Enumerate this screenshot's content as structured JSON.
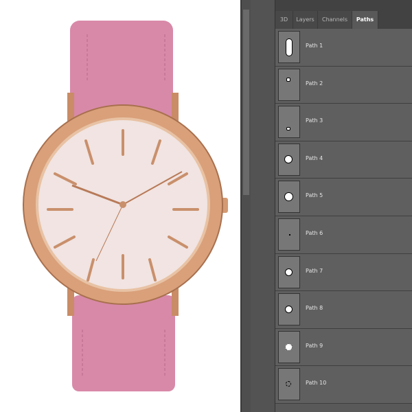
{
  "panel": {
    "tabs": [
      {
        "label": "3D"
      },
      {
        "label": "Layers"
      },
      {
        "label": "Channels"
      },
      {
        "label": "Paths",
        "active": true
      }
    ],
    "paths": [
      {
        "label": "Path 1"
      },
      {
        "label": "Path 2"
      },
      {
        "label": "Path 3"
      },
      {
        "label": "Path 4"
      },
      {
        "label": "Path 5"
      },
      {
        "label": "Path 6"
      },
      {
        "label": "Path 7"
      },
      {
        "label": "Path 8"
      },
      {
        "label": "Path 9"
      },
      {
        "label": "Path 10"
      }
    ]
  },
  "colors": {
    "strap": "#d889a8",
    "case": "#d9a07a",
    "dial": "#f1e4e2",
    "panel": "#595959"
  }
}
